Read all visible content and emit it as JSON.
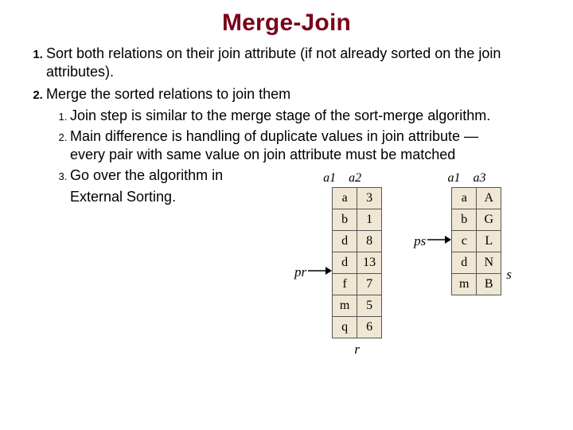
{
  "title": "Merge-Join",
  "items": {
    "i1": "Sort both relations on their join attribute (if not already sorted on the join attributes).",
    "i2": "Merge the sorted relations to join them",
    "i2_1": "Join step is similar to the merge stage of the sort-merge algorithm.",
    "i2_2": "Main difference is handling of duplicate values in join attribute — every pair with same value on join attribute must be matched",
    "i2_3": "Go over the algorithm in",
    "after": "External Sorting."
  },
  "figure": {
    "left": {
      "pointer": "pr",
      "h1": "a1",
      "h2": "a2",
      "name": "r",
      "rows": [
        {
          "c1": "a",
          "c2": "3"
        },
        {
          "c1": "b",
          "c2": "1"
        },
        {
          "c1": "d",
          "c2": "8"
        },
        {
          "c1": "d",
          "c2": "13"
        },
        {
          "c1": "f",
          "c2": "7"
        },
        {
          "c1": "m",
          "c2": "5"
        },
        {
          "c1": "q",
          "c2": "6"
        }
      ]
    },
    "right": {
      "pointer": "ps",
      "h1": "a1",
      "h2": "a3",
      "name": "s",
      "rows": [
        {
          "c1": "a",
          "c2": "A"
        },
        {
          "c1": "b",
          "c2": "G"
        },
        {
          "c1": "c",
          "c2": "L"
        },
        {
          "c1": "d",
          "c2": "N"
        },
        {
          "c1": "m",
          "c2": "B"
        }
      ]
    }
  }
}
